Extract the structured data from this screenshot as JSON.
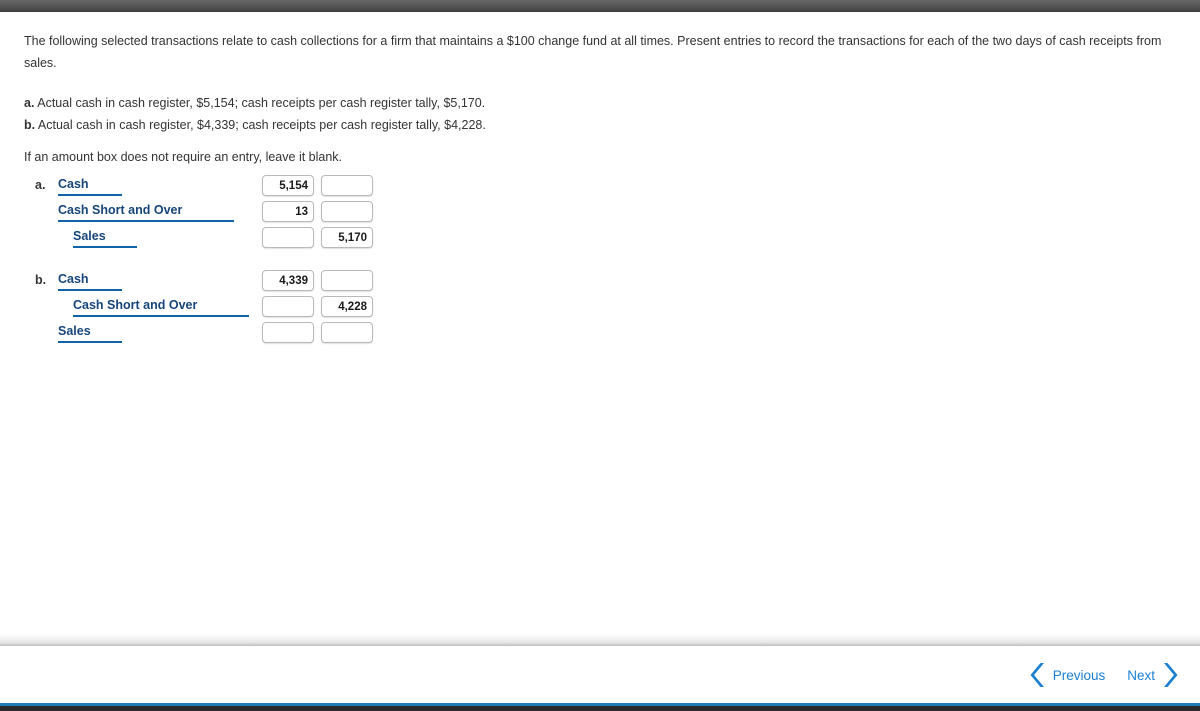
{
  "window": {
    "top_bar_color": "#4e4e4e",
    "bottom_accent_color": "#1f7fb5",
    "bottom_bar_color": "#2b2b2b"
  },
  "colors": {
    "account_text": "#17457a",
    "account_underline": "#1262a8",
    "link_blue": "#1b7fd4",
    "body_text": "#333333",
    "input_border": "#b9b9b9"
  },
  "question": {
    "prompt": "The following selected transactions relate to cash collections for a firm that maintains a $100 change fund at all times. Present entries to record the transactions for each of the two days of cash receipts from sales.",
    "bullets": [
      {
        "letter": "a.",
        "text": "Actual cash in cash register, $5,154; cash receipts per cash register tally, $5,170."
      },
      {
        "letter": "b.",
        "text": "Actual cash in cash register, $4,339; cash receipts per cash register tally, $4,228."
      }
    ],
    "blank_note": "If an amount box does not require an entry, leave it blank."
  },
  "journal": {
    "entries": [
      {
        "letter": "a.",
        "rows": [
          {
            "account": "Cash",
            "indent": 0,
            "debit": "5,154",
            "credit": ""
          },
          {
            "account": "Cash Short and Over",
            "indent": 1,
            "debit": "13",
            "credit": ""
          },
          {
            "account": "Sales",
            "indent": 2,
            "debit": "",
            "credit": "5,170"
          }
        ]
      },
      {
        "letter": "b.",
        "rows": [
          {
            "account": "Cash",
            "indent": 0,
            "debit": "4,339",
            "credit": ""
          },
          {
            "account": "Cash Short and Over",
            "indent": 3,
            "debit": "",
            "credit": "4,228"
          },
          {
            "account": "Sales",
            "indent": 0,
            "debit": "",
            "credit": ""
          }
        ]
      }
    ],
    "amount_placeholder": ""
  },
  "footer": {
    "previous_label": "Previous",
    "next_label": "Next",
    "previous_icon": "chevron-left-icon",
    "next_icon": "chevron-right-icon"
  }
}
